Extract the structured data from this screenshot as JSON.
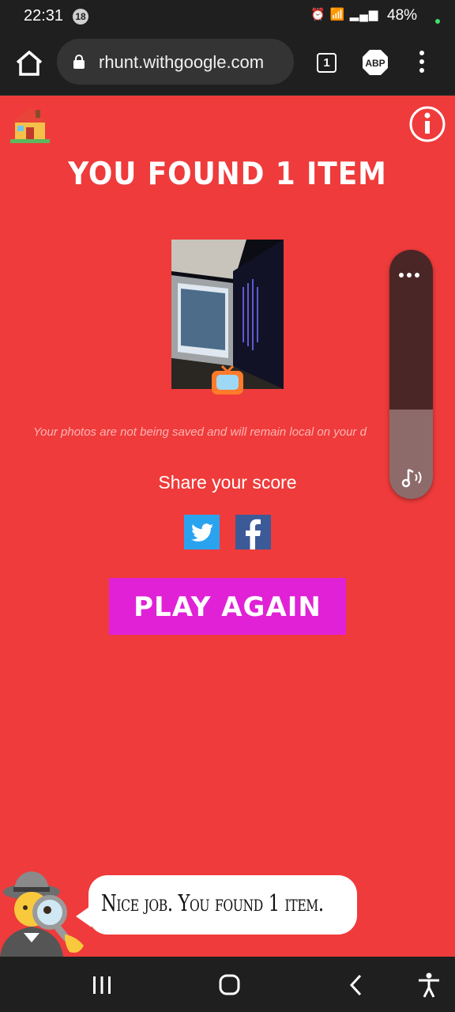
{
  "status_bar": {
    "time": "22:31",
    "notification_count": "18",
    "battery": "48%",
    "icons": [
      "alarm-icon",
      "wifi-icon",
      "wifi-calling-icon",
      "signal-icon",
      "battery-icon"
    ]
  },
  "browser": {
    "url": "rhunt.withgoogle.com",
    "tab_count": "1",
    "adblock_label": "ABP"
  },
  "page": {
    "headline": "YOU FOUND 1 ITEM",
    "disclaimer": "Your photos are not being saved and will remain local on your d",
    "share_label": "Share your score",
    "play_again_label": "PLAY AGAIN",
    "speech": "Nice job. You found 1 item."
  },
  "volume": {
    "level": 0.36
  },
  "colors": {
    "background": "#ef3b3b",
    "play_button": "#e021d6",
    "twitter": "#2aa3ef",
    "facebook": "#3d5a98"
  }
}
